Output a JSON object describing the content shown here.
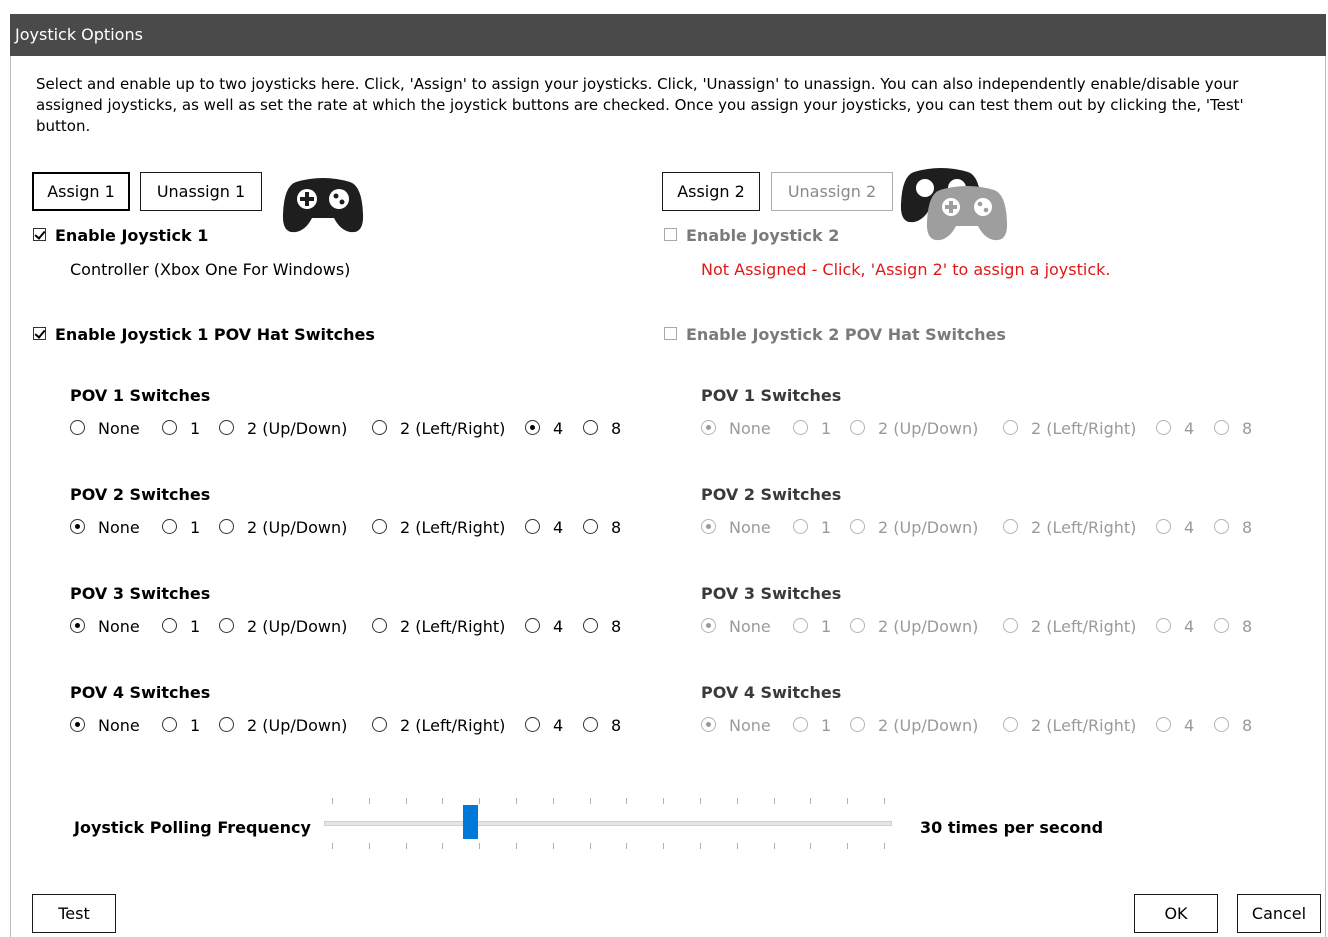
{
  "window": {
    "title": "Joystick Options"
  },
  "description": "Select and enable up to two joysticks here.  Click, 'Assign' to assign your joysticks.  Click, 'Unassign' to unassign.  You can also independently enable/disable your assigned joysticks, as well as set the rate at which the joystick buttons are checked.  Once you assign your joysticks, you can test them out by clicking the, 'Test' button.",
  "joystick1": {
    "assign_label": "Assign 1",
    "unassign_label": "Unassign 1",
    "enable_label": "Enable Joystick 1",
    "enabled": true,
    "device_name": "Controller (Xbox One For Windows)",
    "pov_enable_label": "Enable Joystick 1 POV Hat Switches",
    "pov_enabled": true,
    "pov_groups": [
      {
        "title": "POV 1 Switches",
        "selected": "4"
      },
      {
        "title": "POV 2 Switches",
        "selected": "None"
      },
      {
        "title": "POV 3 Switches",
        "selected": "None"
      },
      {
        "title": "POV 4 Switches",
        "selected": "None"
      }
    ]
  },
  "joystick2": {
    "assign_label": "Assign 2",
    "unassign_label": "Unassign 2",
    "enable_label": "Enable Joystick 2",
    "enabled": false,
    "status_message": "Not Assigned - Click, 'Assign 2' to assign a joystick.",
    "status_color": "#e01818",
    "pov_enable_label": "Enable Joystick 2 POV Hat Switches",
    "pov_enabled": false,
    "pov_groups": [
      {
        "title": "POV 1 Switches",
        "selected": "None"
      },
      {
        "title": "POV 2 Switches",
        "selected": "None"
      },
      {
        "title": "POV 3 Switches",
        "selected": "None"
      },
      {
        "title": "POV 4 Switches",
        "selected": "None"
      }
    ]
  },
  "pov_options": [
    "None",
    "1",
    "2 (Up/Down)",
    "2 (Left/Right)",
    "4",
    "8"
  ],
  "polling": {
    "label": "Joystick Polling Frequency",
    "value_text": "30 times per second",
    "slider_fraction": 0.25,
    "tick_count": 16
  },
  "footer": {
    "test_label": "Test",
    "ok_label": "OK",
    "cancel_label": "Cancel"
  },
  "colors": {
    "accent": "#0078d7",
    "titlebar": "#4a4a4a",
    "error": "#e01818"
  },
  "icons": {
    "joystick1": "gamepad-icon",
    "joystick2": "gamepad-pair-icon"
  }
}
